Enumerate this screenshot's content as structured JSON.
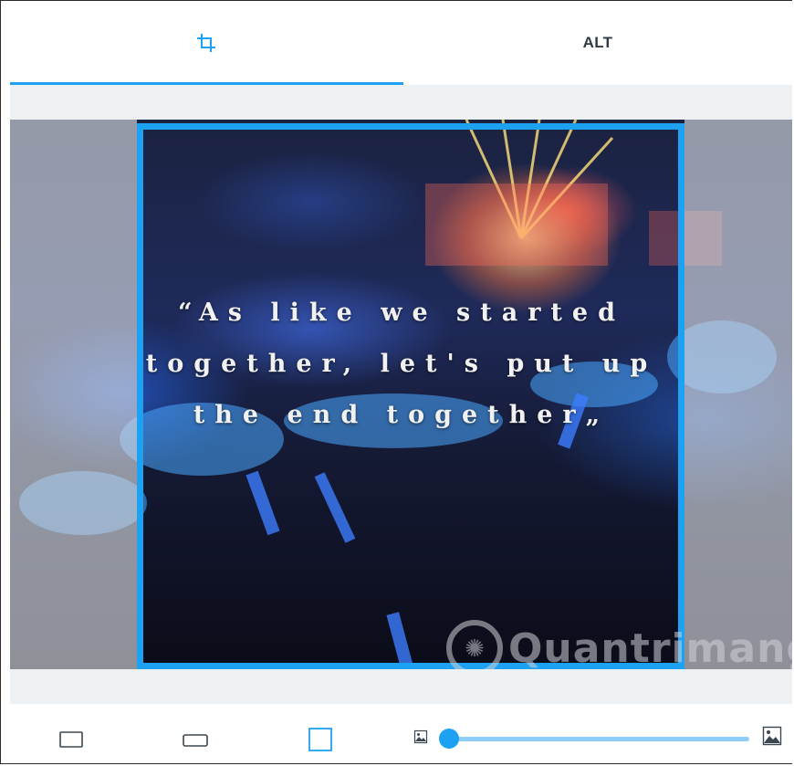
{
  "tabs": {
    "crop_icon": "crop-icon",
    "alt_label": "ALT",
    "active": "crop"
  },
  "image": {
    "quote_lines": [
      "“As like we started",
      "together, let's put up",
      "the end together„"
    ],
    "watermark_text": "Quantrimang"
  },
  "toolbar": {
    "aspect_ratios": [
      "original",
      "wide",
      "square"
    ],
    "selected_ratio": "square",
    "zoom_min_icon": "image-small-icon",
    "zoom_max_icon": "image-large-icon",
    "zoom_level": 0
  },
  "colors": {
    "accent": "#1da1f2",
    "track": "#8ecdf8",
    "text_dark": "#2e3a45"
  }
}
